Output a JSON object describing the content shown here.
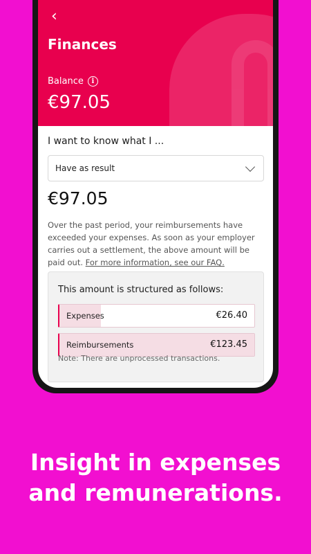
{
  "header": {
    "back_icon": "chevron-left-icon",
    "title": "Finances",
    "balance_label": "Balance",
    "info_icon": "info-icon",
    "balance_value": "€97.05"
  },
  "colors": {
    "background": "#f20fd0",
    "header": "#e8004e",
    "accent": "#e8004e"
  },
  "query": {
    "question": "I want to know what I ...",
    "select_value": "Have as result",
    "select_icon": "chevron-down-icon"
  },
  "result": {
    "amount": "€97.05",
    "explanation": "Over the past period, your reimbursements have exceeded your expenses. As soon as your employer carries out a settlement, the above amount will be paid out.",
    "faq_link": "For more information, see our FAQ."
  },
  "structure": {
    "title": "This amount is structured as follows:",
    "rows": [
      {
        "label": "Expenses",
        "amount": "€26.40",
        "fill_fraction": 0.214
      },
      {
        "label": "Reimbursements",
        "amount": "€123.45",
        "fill_fraction": 1.0
      }
    ],
    "note": "Note: There are unprocessed transactions."
  },
  "promo": {
    "line1": "Insight in expenses",
    "line2": "and remunerations."
  }
}
